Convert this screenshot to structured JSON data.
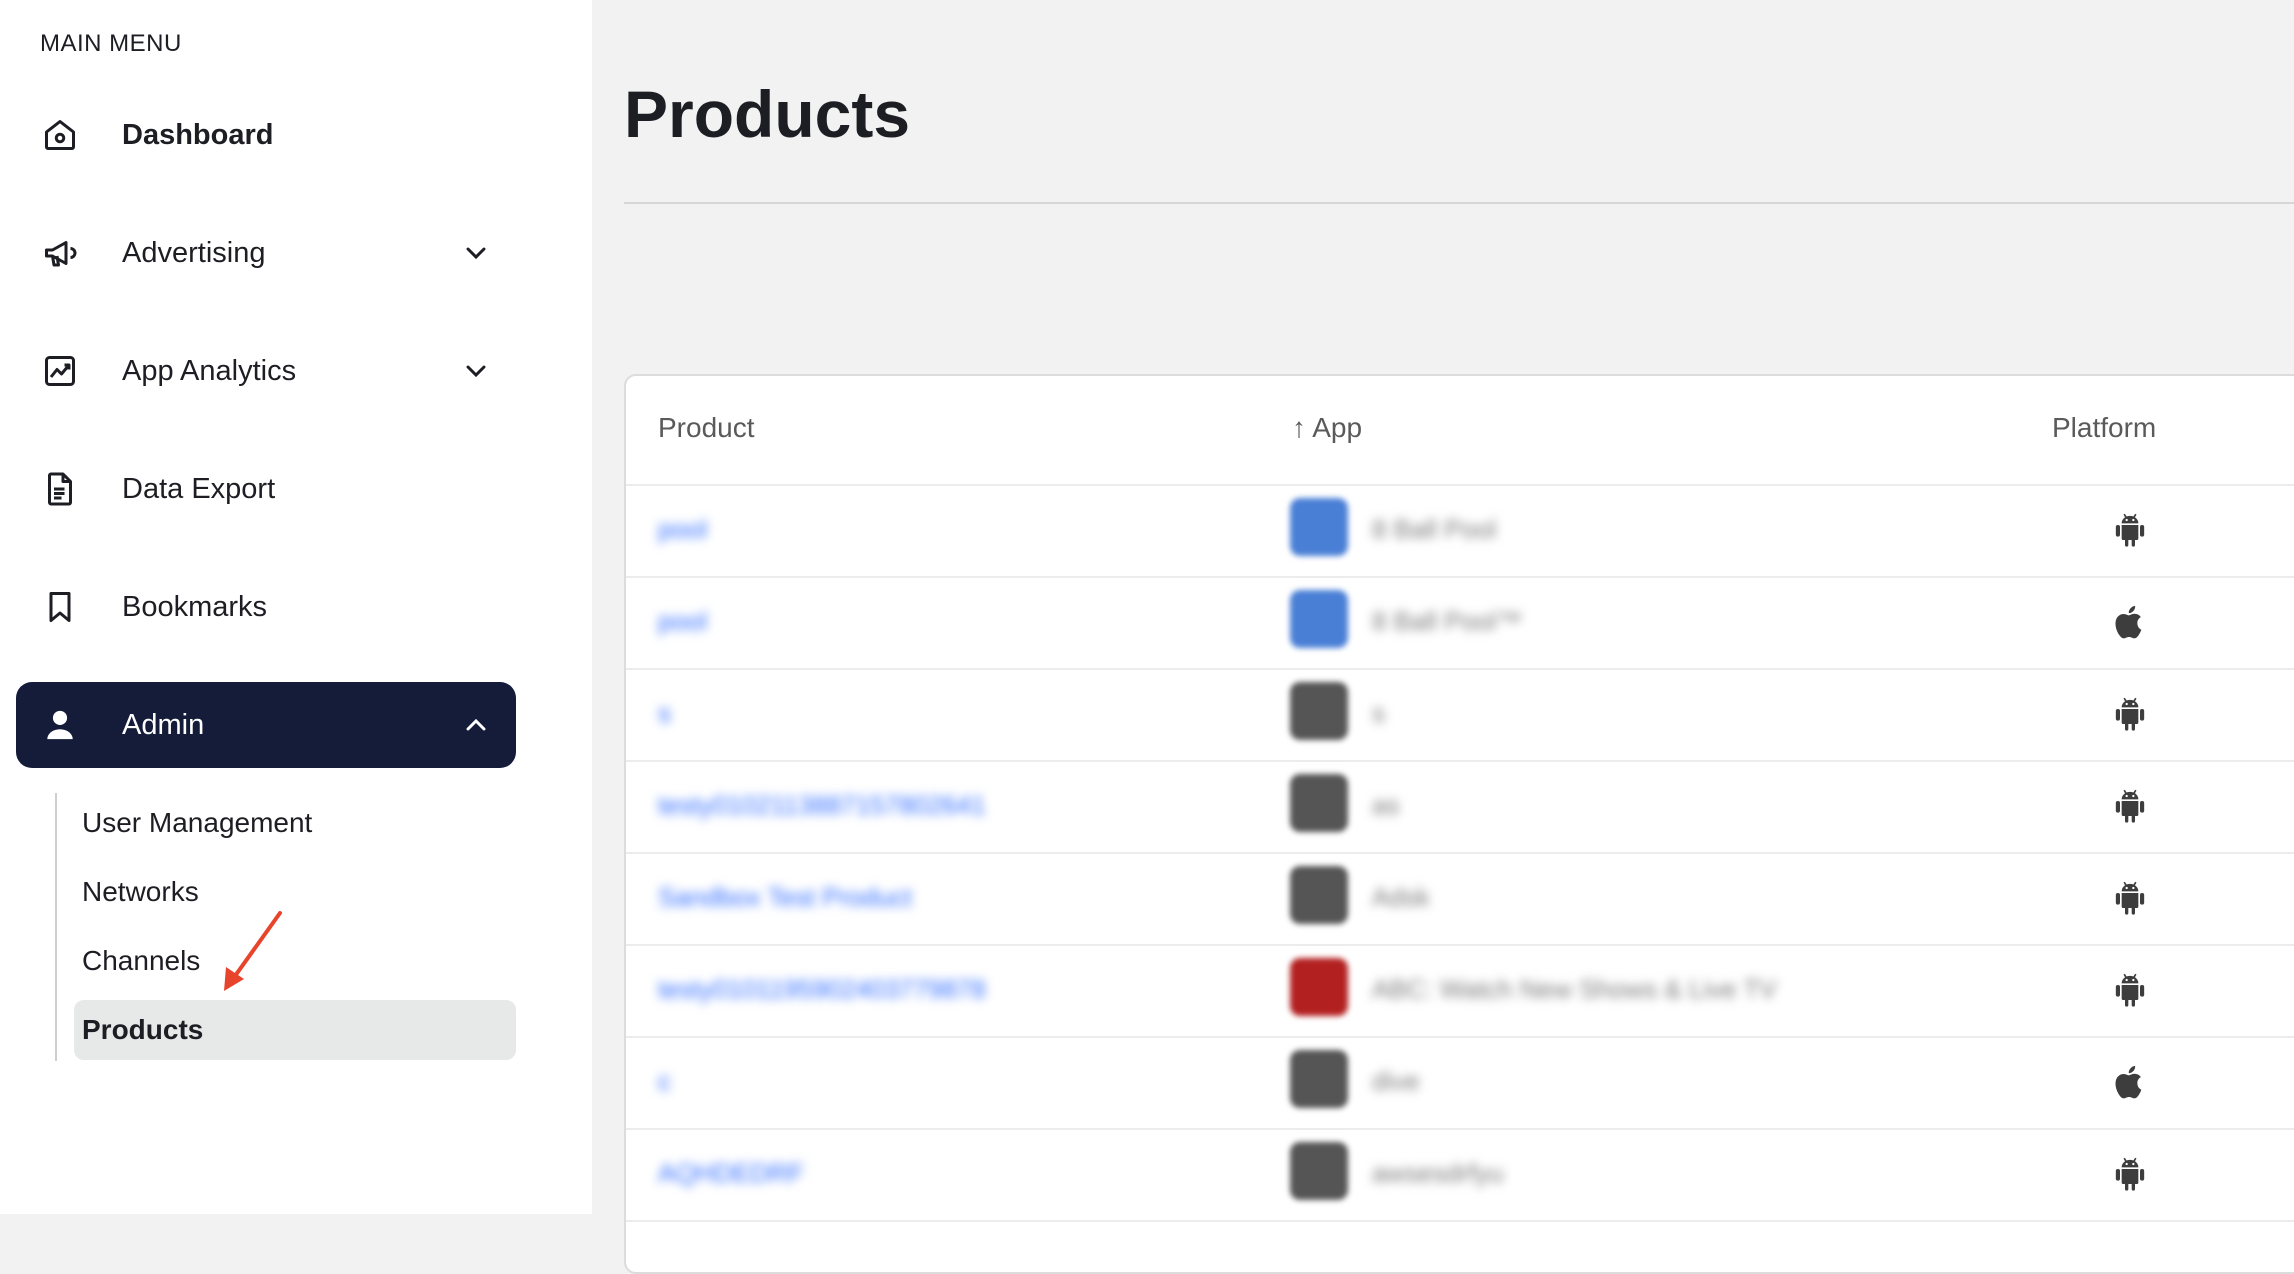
{
  "sidebar": {
    "heading": "MAIN MENU",
    "items": [
      {
        "label": "Dashboard",
        "icon": "home-icon"
      },
      {
        "label": "Advertising",
        "icon": "megaphone-icon"
      },
      {
        "label": "App Analytics",
        "icon": "chart-icon"
      },
      {
        "label": "Data Export",
        "icon": "document-icon"
      },
      {
        "label": "Bookmarks",
        "icon": "bookmark-icon"
      },
      {
        "label": "Admin",
        "icon": "user-icon"
      }
    ],
    "admin_sub_items": [
      {
        "label": "User Management"
      },
      {
        "label": "Networks"
      },
      {
        "label": "Channels"
      },
      {
        "label": "Products"
      }
    ]
  },
  "page": {
    "title": "Products"
  },
  "table": {
    "columns": [
      "Product",
      "↑ App",
      "Platform"
    ],
    "rows": [
      {
        "product": "pool",
        "app": "8 Ball Pool",
        "platform": "android",
        "app_color": "#4a7fd6"
      },
      {
        "product": "pool",
        "app": "8 Ball Pool™",
        "platform": "apple",
        "app_color": "#4a7fd6"
      },
      {
        "product": "s",
        "app": "s",
        "platform": "android",
        "app_color": "#555555"
      },
      {
        "product": "testy0102113887157802641",
        "app": "as",
        "platform": "android",
        "app_color": "#555555"
      },
      {
        "product": "Sandbox Test Product",
        "app": "Adsk",
        "platform": "android",
        "app_color": "#555555"
      },
      {
        "product": "testy0101195902403779878",
        "app": "ABC: Watch New Shows & Live TV",
        "platform": "android",
        "app_color": "#b32020"
      },
      {
        "product": "c",
        "app": "dive",
        "platform": "apple",
        "app_color": "#555555"
      },
      {
        "product": "AQHDEDRF",
        "app": "awsesdrfyu",
        "platform": "android",
        "app_color": "#555555"
      }
    ]
  }
}
